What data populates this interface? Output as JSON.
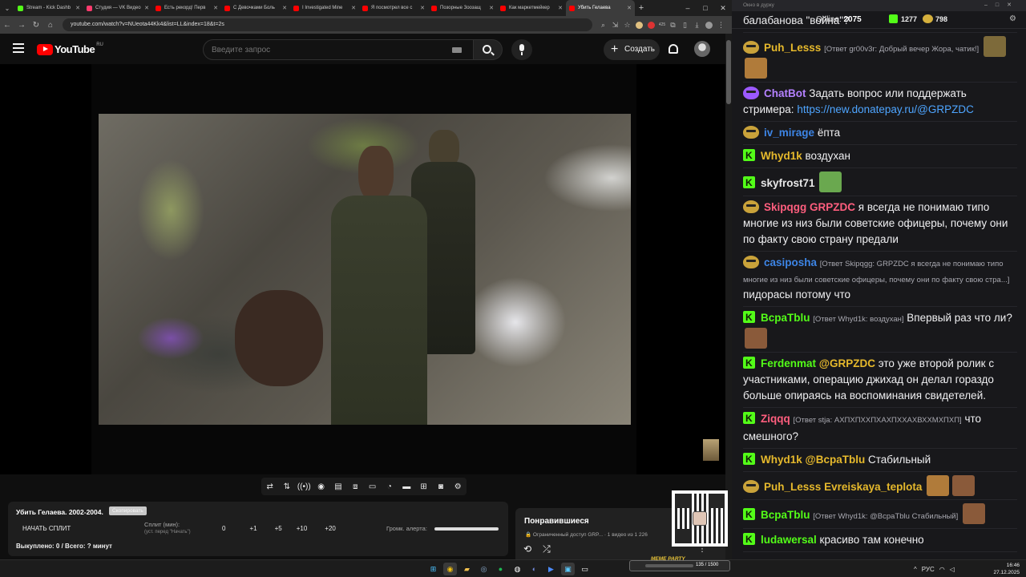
{
  "browser": {
    "tabs": [
      {
        "label": "Stream - Kick Dashb",
        "favicon_color": "#53fc18"
      },
      {
        "label": "Студия — VK Видео",
        "favicon_color": "#ff3a6d"
      },
      {
        "label": "Есть рекорд! Перв",
        "favicon_color": "#ff0000"
      },
      {
        "label": "С Девочками Боль",
        "favicon_color": "#ff0000"
      },
      {
        "label": "I Investigated Mine",
        "favicon_color": "#ff0000"
      },
      {
        "label": "Я посмотрел все с",
        "favicon_color": "#ff0000"
      },
      {
        "label": "Позорные Зоозащ",
        "favicon_color": "#ff0000"
      },
      {
        "label": "Как маркетмейкер",
        "favicon_color": "#ff0000"
      },
      {
        "label": "Убить Гелаева",
        "favicon_color": "#ff0000",
        "active": true
      }
    ],
    "url": "youtube.com/watch?v=NUeota44Kk4&list=LL&index=18&t=2s",
    "extension_badge": "425"
  },
  "youtube": {
    "logo_text": "YouTube",
    "country": "RU",
    "search_placeholder": "Введите запрос",
    "create_label": "Создать"
  },
  "extension_panel": {
    "video_title": "Убить Гелаева. 2002-2004.",
    "copy_label": "Скопировать",
    "split_button": "НАЧАТЬ СПЛИТ",
    "split_label": "Сплит (мин):",
    "split_sub": "(уст. перед \"Начать\")",
    "split_values": [
      "0",
      "+1",
      "+5",
      "+10",
      "+20"
    ],
    "alert_label": "Громк. алерта:",
    "alert_volume_fraction": 1.0,
    "bought_label": "Выкуплено: 0 / Всего: ? минут"
  },
  "playlist": {
    "title": "Понравившиеся",
    "subtitle": "🔒 Ограниченный доступ GRP... · 1 видео из 1 226"
  },
  "chat": {
    "window_title": "Окно в дурку",
    "online_label": "Online:",
    "online_value": "2075",
    "kick_count": "1277",
    "emote_count": "798",
    "first_line": "балабанова \"война\"?",
    "messages": [
      {
        "user": "Puh_Lesss",
        "color": "#e6b92c",
        "badge": "e",
        "reply": "[Ответ gr00v3r: Добрый вечер Жора, чатик!]",
        "text": ""
      },
      {
        "user": "ChatBot",
        "color": "#b481ff",
        "badge": "bot",
        "reply": "",
        "text": "Задать вопрос или поддержать стримера:",
        "link": "https://new.donatepay.ru/@GRPZDC"
      },
      {
        "user": "iv_mirage",
        "color": "#3d85e6",
        "badge": "e",
        "reply": "",
        "text": "ёпта"
      },
      {
        "user": "Whyd1k",
        "color": "#e6b92c",
        "badge": "k",
        "reply": "",
        "text": "воздухан"
      },
      {
        "user": "skyfrost71",
        "color": "#e8e8e8",
        "badge": "k",
        "reply": "",
        "text": ""
      },
      {
        "user": "Skipqgg",
        "color": "#ff5e7e",
        "badge": "e",
        "reply": "",
        "mention": "GRPZDC",
        "mention_color": "#ff5e7e",
        "text": "я всегда не понимаю типо многие из низ были советские офицеры, почему они по факту свою страну предали"
      },
      {
        "user": "casiposha",
        "color": "#3d85e6",
        "badge": "e",
        "reply": "[Ответ Skipqgg: GRPZDC я всегда не понимаю типо многие из низ были советские офицеры, почему они по факту свою стра...]",
        "text": "пидорасы потому что"
      },
      {
        "user": "BcpaTblu",
        "color": "#53fc18",
        "badge": "k",
        "reply": "[Ответ Whyd1k: воздухан]",
        "text": "Впервый раз что ли?"
      },
      {
        "user": "Ferdenmat",
        "color": "#53fc18",
        "badge": "k",
        "reply": "",
        "mention": "@GRPZDC",
        "mention_color": "#e6b92c",
        "text": "это уже второй ролик с участниками, операцию джихад он делал гораздо больше опираясь на воспоминания свидетелей."
      },
      {
        "user": "Ziqqq",
        "color": "#ff5e7e",
        "badge": "k",
        "reply": "[Ответ stja: АХПХПХХПХАХПХХАХВХХМХПХП]",
        "text": "что смешного?"
      },
      {
        "user": "Whyd1k",
        "color": "#e6b92c",
        "badge": "k",
        "reply": "",
        "mention": "@BcpaTblu",
        "mention_color": "#e6b92c",
        "text": "Стабильный"
      },
      {
        "user": "Puh_Lesss",
        "color": "#e6b92c",
        "badge": "e",
        "reply": "",
        "mention": "Evreiskaya_teplota",
        "mention_color": "#e6b92c",
        "text": ""
      },
      {
        "user": "BcpaTblu",
        "color": "#53fc18",
        "badge": "k",
        "reply": "[Ответ Whyd1k: @BcpaTblu Стабильный]",
        "text": ""
      },
      {
        "user": "ludawersal",
        "color": "#53fc18",
        "badge": "k",
        "reply": "",
        "text": "красиво там конечно"
      }
    ]
  },
  "taskbar": {
    "meme_title": "MEME PARTY",
    "meme_value": "135 / 1500",
    "lang": "РУС",
    "time": "16:46",
    "date": "27.12.2025"
  }
}
